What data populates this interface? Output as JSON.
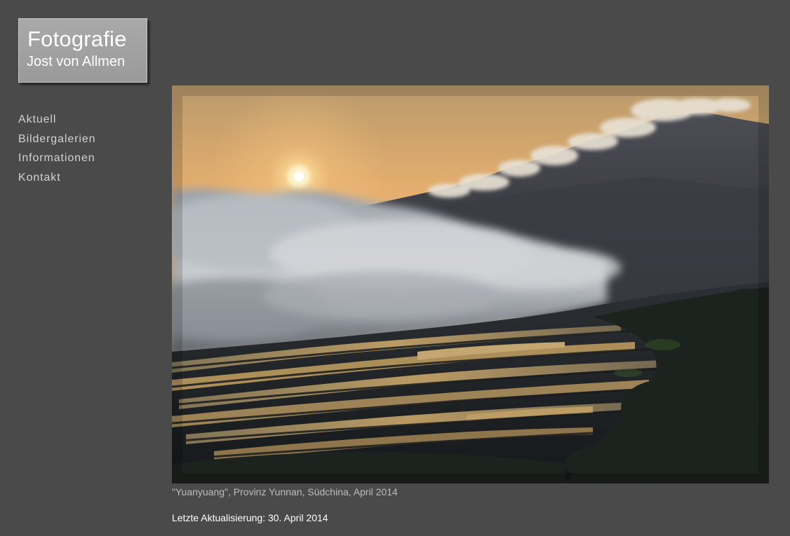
{
  "logo": {
    "title": "Fotografie",
    "subtitle": "Jost von Allmen"
  },
  "nav": {
    "items": [
      {
        "label": "Aktuell"
      },
      {
        "label": "Bildergalerien"
      },
      {
        "label": "Informationen"
      },
      {
        "label": "Kontakt"
      }
    ]
  },
  "photo": {
    "caption": "\"Yuanyuang\", Provinz Yunnan, Südchina, April 2014"
  },
  "footer": {
    "last_update": "Letzte Aktualisierung: 30. April 2014"
  },
  "colors": {
    "background": "#4a4a4a",
    "nav_text": "#d3d3d3",
    "caption_text": "#bdbdbd",
    "logo_background": "#a0a0a0"
  }
}
